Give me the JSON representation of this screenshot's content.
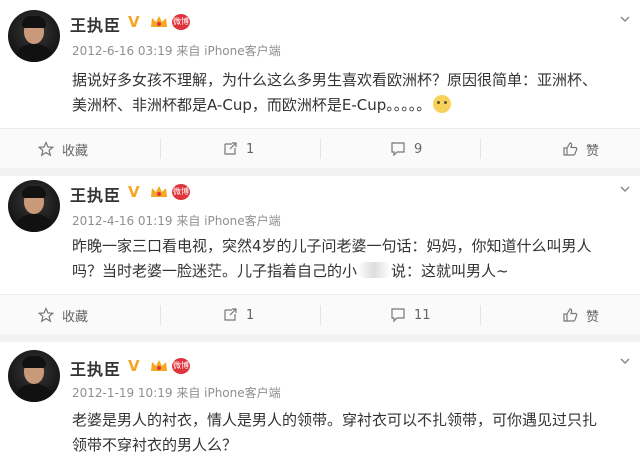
{
  "posts": [
    {
      "name": "王执臣",
      "vip_label": "微博",
      "meta": "2012-6-16 03:19 来自 iPhone客户端",
      "content_1": "据说好多女孩不理解，为什么这么多男生喜欢看欧洲杯？原因很简单：亚洲杯、",
      "content_2": "美洲杯、非洲杯都是A-Cup，而欧洲杯是E-Cup。。。。。",
      "actions": {
        "collect": "收藏",
        "repost": "1",
        "comment": "9",
        "like": "赞"
      }
    },
    {
      "name": "王执臣",
      "vip_label": "微博",
      "meta": "2012-4-16 01:19 来自 iPhone客户端",
      "content_1": "昨晚一家三口看电视，突然4岁的儿子问老婆一句话：妈妈，你知道什么叫男人",
      "content_2a": "吗？当时老婆一脸迷茫。儿子指着自己的小",
      "content_2b": "说：这就叫男人~",
      "actions": {
        "collect": "收藏",
        "repost": "1",
        "comment": "11",
        "like": "赞"
      }
    },
    {
      "name": "王执臣",
      "vip_label": "微博",
      "meta": "2012-1-19 10:19 来自 iPhone客户端",
      "content_1": "老婆是男人的衬衣，情人是男人的领带。穿衬衣可以不扎领带，可你遇见过只扎",
      "content_2": "领带不穿衬衣的男人么？"
    }
  ],
  "colors": {
    "verified": "#f5a623",
    "vip": "#e0343c",
    "meta": "#8f8f8f"
  },
  "icons": [
    "star-icon",
    "share-icon",
    "comment-icon",
    "thumbs-up-icon",
    "chevron-down-icon",
    "crown-icon"
  ]
}
